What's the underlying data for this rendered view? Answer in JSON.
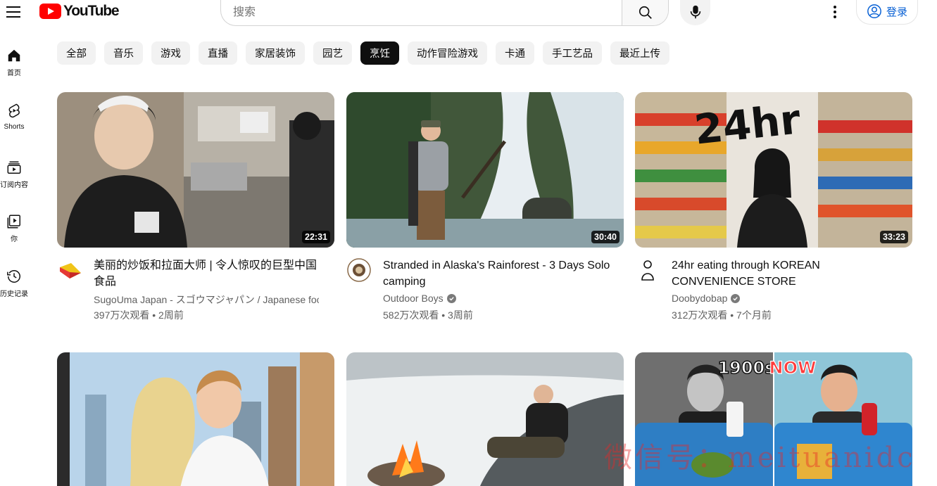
{
  "header": {
    "brand": "YouTube",
    "search_placeholder": "搜索",
    "signin_label": "登录"
  },
  "sidebar": {
    "items": [
      {
        "label": "首页",
        "icon": "home-icon"
      },
      {
        "label": "Shorts",
        "icon": "shorts-icon"
      },
      {
        "label": "订阅内容",
        "icon": "subscriptions-icon"
      },
      {
        "label": "你",
        "icon": "you-icon"
      },
      {
        "label": "历史记录",
        "icon": "history-icon"
      }
    ]
  },
  "chips": [
    {
      "label": "全部",
      "active": false
    },
    {
      "label": "音乐",
      "active": false
    },
    {
      "label": "游戏",
      "active": false
    },
    {
      "label": "直播",
      "active": false
    },
    {
      "label": "家居装饰",
      "active": false
    },
    {
      "label": "园艺",
      "active": false
    },
    {
      "label": "烹饪",
      "active": true
    },
    {
      "label": "动作冒险游戏",
      "active": false
    },
    {
      "label": "卡通",
      "active": false
    },
    {
      "label": "手工艺品",
      "active": false
    },
    {
      "label": "最近上传",
      "active": false
    }
  ],
  "videos": [
    {
      "title": "美丽的炒饭和拉面大师 | 令人惊叹的巨型中国食品",
      "channel": "SugoUma Japan - スゴウマジャパン / Japanese food",
      "verified": false,
      "stats": "397万次观看 • 2周前",
      "duration": "22:31"
    },
    {
      "title": "Stranded in Alaska's Rainforest - 3 Days Solo camping",
      "channel": "Outdoor Boys",
      "verified": true,
      "stats": "582万次观看 • 3周前",
      "duration": "30:40"
    },
    {
      "title": "24hr eating through KOREAN CONVENIENCE STORE",
      "channel": "Doobydobap",
      "verified": true,
      "stats": "312万次观看 • 7个月前",
      "duration": "33:23"
    },
    {
      "title": "",
      "channel": "",
      "stats": "",
      "duration": ""
    },
    {
      "title": "",
      "channel": "",
      "stats": "",
      "duration": ""
    },
    {
      "title": "",
      "channel": "",
      "stats": "",
      "duration": "",
      "thumb_text_left": "1900s",
      "thumb_text_right": "NOW"
    }
  ],
  "thumb_texts": {
    "v3_overlay": "24hr"
  },
  "watermark": "微信号：meituanidc",
  "colors": {
    "brand_red": "#ff0000",
    "link_blue": "#065fd4",
    "chip_bg": "#f2f2f2",
    "chip_active_bg": "#0f0f0f",
    "secondary_text": "#606060"
  }
}
